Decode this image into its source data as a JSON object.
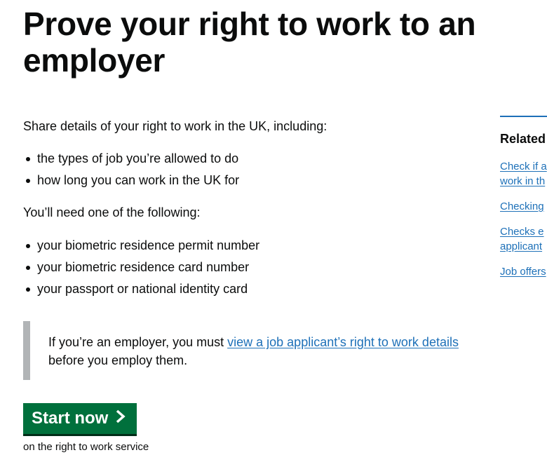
{
  "heading": "Prove your right to work to an employer",
  "intro": "Share details of your right to work in the UK, including:",
  "intro_bullets": [
    "the types of job you’re allowed to do",
    "how long you can work in the UK for"
  ],
  "need_text": "You’ll need one of the following:",
  "need_bullets": [
    "your biometric residence permit number",
    "your biometric residence card number",
    "your passport or national identity card"
  ],
  "inset": {
    "prefix": "If you’re an employer, you must ",
    "link_text": "view a job applicant’s right to work details",
    "suffix": "before you employ them."
  },
  "start_button": {
    "label": "Start now",
    "icon": "chevron-right-icon"
  },
  "start_caption": "on the right to work service",
  "sidebar": {
    "heading": "Related",
    "links": [
      "Check if a",
      "work in th",
      "Checking",
      "Checks e",
      "applicant",
      "Job offers"
    ]
  },
  "colors": {
    "text": "#0b0c0c",
    "link": "#1d70b8",
    "button": "#00703c",
    "inset_border": "#b1b4b6",
    "sidebar_rule": "#1d70b8"
  }
}
